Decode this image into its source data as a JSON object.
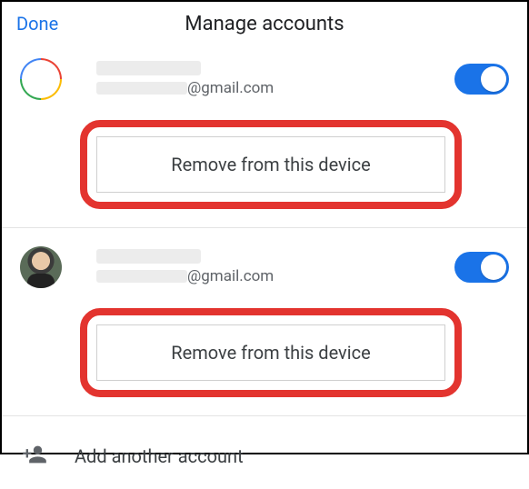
{
  "header": {
    "done_label": "Done",
    "title": "Manage accounts"
  },
  "accounts": [
    {
      "email_suffix": "@gmail.com",
      "toggle_on": true,
      "remove_label": "Remove from this device"
    },
    {
      "email_suffix": "@gmail.com",
      "toggle_on": true,
      "remove_label": "Remove from this device"
    }
  ],
  "add_account_label": "Add another account",
  "colors": {
    "accent": "#1a73e8",
    "highlight_border": "#e3342f"
  }
}
